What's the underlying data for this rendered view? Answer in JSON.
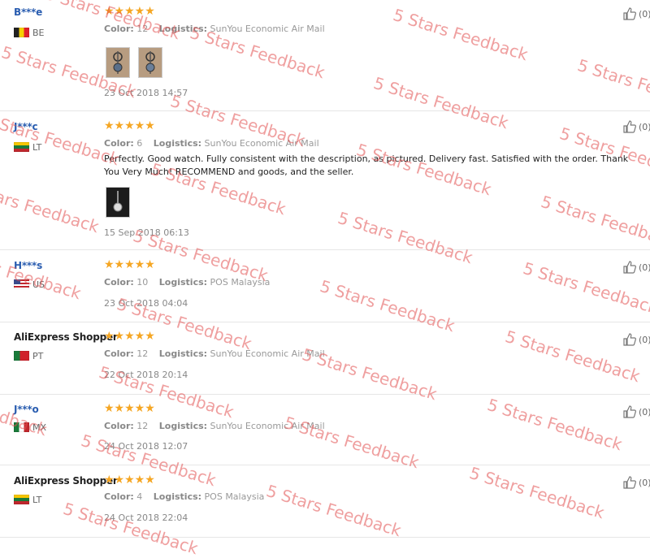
{
  "reviews": [
    {
      "user": "B***e",
      "country": "BE",
      "flag": "be",
      "stars": "★★★★★",
      "color_label": "Color:",
      "color": "12",
      "logistics_label": "Logistics:",
      "logistics": "SunYou Economic Air Mail",
      "feedback": "",
      "photos": 2,
      "date": "23 Oct 2018 14:57",
      "likes": "(0)"
    },
    {
      "user": "J***c",
      "country": "LT",
      "flag": "lt",
      "stars": "★★★★★",
      "color_label": "Color:",
      "color": "6",
      "logistics_label": "Logistics:",
      "logistics": "SunYou Economic Air Mail",
      "feedback": "Perfectly. Good watch. Fully consistent with the description, as pictured. Delivery fast. Satisfied with the order. Thank You Very Much! RECOMMEND and goods, and the seller.",
      "photos": 1,
      "date": "15 Sep 2018 06:13",
      "likes": "(0)"
    },
    {
      "user": "H***s",
      "country": "US",
      "flag": "us",
      "stars": "★★★★★",
      "color_label": "Color:",
      "color": "10",
      "logistics_label": "Logistics:",
      "logistics": "POS Malaysia",
      "feedback": "",
      "photos": 0,
      "date": "23 Oct 2018 04:04",
      "likes": "(0)"
    },
    {
      "user": "AliExpress Shopper",
      "country": "PT",
      "flag": "pt",
      "stars": "★★★★★",
      "color_label": "Color:",
      "color": "12",
      "logistics_label": "Logistics:",
      "logistics": "SunYou Economic Air Mail",
      "feedback": "",
      "photos": 0,
      "date": "22 Oct 2018 20:14",
      "likes": "(0)"
    },
    {
      "user": "J***o",
      "country": "MX",
      "flag": "mx",
      "stars": "★★★★★",
      "color_label": "Color:",
      "color": "12",
      "logistics_label": "Logistics:",
      "logistics": "SunYou Economic Air Mail",
      "feedback": "",
      "photos": 0,
      "date": "24 Oct 2018 12:07",
      "likes": "(0)"
    },
    {
      "user": "AliExpress Shopper",
      "country": "LT",
      "flag": "lt",
      "stars": "★★★★★",
      "color_label": "Color:",
      "color": "4",
      "logistics_label": "Logistics:",
      "logistics": "POS Malaysia",
      "feedback": "",
      "photos": 0,
      "date": "24 Oct 2018 22:04",
      "likes": "(0)"
    }
  ],
  "watermark": {
    "text": "5 Stars Feedback",
    "color": "#e15050"
  },
  "icons": {
    "like": "thumbs-up-icon",
    "star": "star-icon",
    "photo": "watch-photo-icon"
  }
}
